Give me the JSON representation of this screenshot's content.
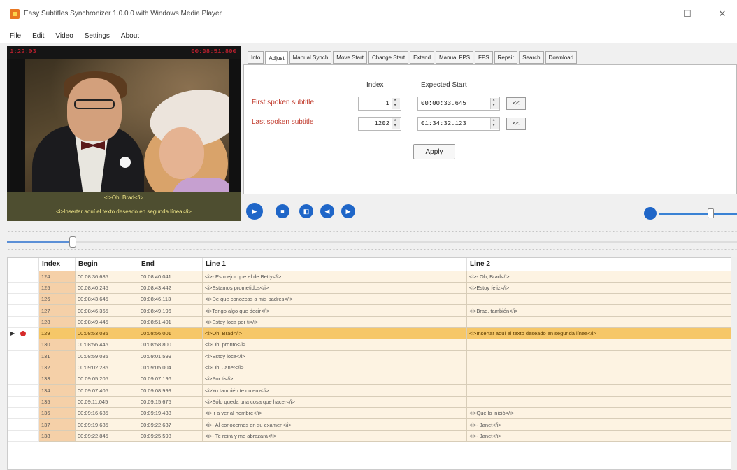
{
  "window": {
    "title": "Easy Subtitles Synchronizer 1.0.0.0 with Windows Media Player",
    "minimize": "—",
    "maximize": "☐",
    "close": "✕"
  },
  "menu": [
    "File",
    "Edit",
    "Video",
    "Settings",
    "About"
  ],
  "video": {
    "time_left": "1:22:03",
    "time_right": "00:08:51.800",
    "subtitle_line1": "<i>Oh, Brad</i>",
    "subtitle_line2": "<i>Insertar aquí el texto deseado en segunda línea</i>"
  },
  "tabs": [
    "Info",
    "Adjust",
    "Manual Synch",
    "Move Start",
    "Change Start",
    "Extend",
    "Manual FPS",
    "FPS",
    "Repair",
    "Search",
    "Download"
  ],
  "active_tab": "Adjust",
  "adjust": {
    "header_index": "Index",
    "header_expected_start": "Expected Start",
    "first_label": "First spoken subtitle",
    "last_label": "Last spoken subtitle",
    "first_index": "1",
    "last_index": "1202",
    "first_start": "00:00:33.645",
    "last_start": "01:34:32.123",
    "set_button": "<<",
    "apply_button": "Apply"
  },
  "player": {
    "buttons": [
      "play-icon",
      "stop-icon",
      "frame-step-icon",
      "rewind-icon",
      "forward-icon"
    ],
    "volume_level": 0.7,
    "timeline_position": 0.09
  },
  "grid": {
    "columns": [
      "Index",
      "Begin",
      "End",
      "Line 1",
      "Line 2"
    ],
    "selected_index": "129",
    "rows": [
      {
        "index": "124",
        "begin": "00:08:36.685",
        "end": "00:08:40.041",
        "line1": "<i>- Es mejor que el de Betty</i>",
        "line2": "<i>- Oh, Brad</i>"
      },
      {
        "index": "125",
        "begin": "00:08:40.245",
        "end": "00:08:43.442",
        "line1": "<i>Estamos prometidos</i>",
        "line2": "<i>Estoy feliz</i>"
      },
      {
        "index": "126",
        "begin": "00:08:43.645",
        "end": "00:08:46.113",
        "line1": "<i>De que conozcas a mis padres</i>",
        "line2": ""
      },
      {
        "index": "127",
        "begin": "00:08:46.365",
        "end": "00:08:49.196",
        "line1": "<i>Tengo algo que decir</i>",
        "line2": "<i>Brad, también</i>"
      },
      {
        "index": "128",
        "begin": "00:08:49.445",
        "end": "00:08:51.401",
        "line1": "<i>Estoy loca por ti</i>",
        "line2": ""
      },
      {
        "index": "129",
        "begin": "00:08:53.085",
        "end": "00:08:56.001",
        "line1": "<i>Oh, Brad</i>",
        "line2": "<i>Insertar aquí el texto deseado en segunda línea</i>"
      },
      {
        "index": "130",
        "begin": "00:08:56.445",
        "end": "00:08:58.800",
        "line1": "<i>Oh, pronto</i>",
        "line2": ""
      },
      {
        "index": "131",
        "begin": "00:08:59.085",
        "end": "00:09:01.599",
        "line1": "<i>Estoy loca</i>",
        "line2": ""
      },
      {
        "index": "132",
        "begin": "00:09:02.285",
        "end": "00:09:05.004",
        "line1": "<i>Oh, Janet</i>",
        "line2": ""
      },
      {
        "index": "133",
        "begin": "00:09:05.205",
        "end": "00:09:07.196",
        "line1": "<i>Por ti</i>",
        "line2": ""
      },
      {
        "index": "134",
        "begin": "00:09:07.405",
        "end": "00:09:08.999",
        "line1": "<i>Yo también te quiero</i>",
        "line2": ""
      },
      {
        "index": "135",
        "begin": "00:09:11.045",
        "end": "00:09:15.675",
        "line1": "<i>Sólo queda una cosa que hacer</i>",
        "line2": ""
      },
      {
        "index": "136",
        "begin": "00:09:16.685",
        "end": "00:09:19.438",
        "line1": "<i>Ir a ver al hombre</i>",
        "line2": "<i>Que lo inició</i>"
      },
      {
        "index": "137",
        "begin": "00:09:19.685",
        "end": "00:09:22.637",
        "line1": "<i>- Al conocernos en su examen</i>",
        "line2": "<i>- Janet</i>"
      },
      {
        "index": "138",
        "begin": "00:09:22.845",
        "end": "00:09:25.598",
        "line1": "<i>- Te reirá y me abrazará</i>",
        "line2": "<i>- Janet</i>"
      }
    ]
  }
}
